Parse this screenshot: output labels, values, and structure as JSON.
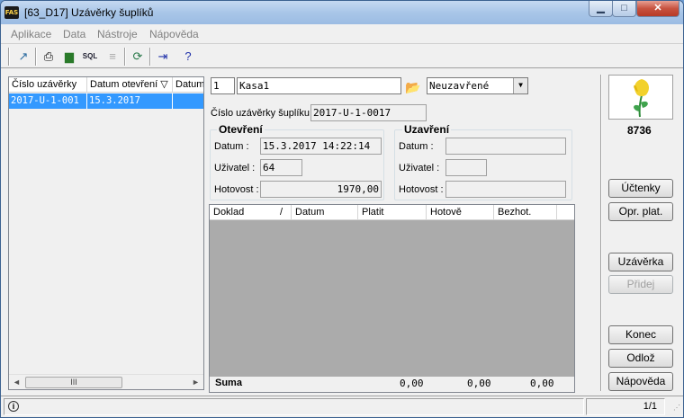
{
  "window": {
    "title": "[63_D17] Uzávěrky šuplíků",
    "app_icon": "FAS"
  },
  "menu": [
    "Aplikace",
    "Data",
    "Nástroje",
    "Nápověda"
  ],
  "toolbar": {
    "sql_label": "SQL"
  },
  "list": {
    "columns": [
      "Číslo uzávěrky",
      "Datum otevření",
      "Datum"
    ],
    "sort_indicator": "▽",
    "rows": [
      {
        "cislo": "2017-U-1-001",
        "datum_otevreni": "15.3.2017"
      }
    ],
    "scroll_thumb": "III"
  },
  "form": {
    "kasa_num": "1",
    "kasa_name": "Kasa1",
    "state": "Neuzavřené",
    "cislo_label": "Číslo uzávěrky šuplíku",
    "cislo_value": "2017-U-1-0017",
    "opening": {
      "title": "Otevření",
      "datum_label": "Datum :",
      "datum_value": "15.3.2017 14:22:14",
      "uzivatel_label": "Uživatel :",
      "uzivatel_value": "64",
      "hotovost_label": "Hotovost :",
      "hotovost_value": "1970,00"
    },
    "closing": {
      "title": "Uzavření",
      "datum_label": "Datum :",
      "datum_value": "",
      "uzivatel_label": "Uživatel :",
      "uzivatel_value": "",
      "hotovost_label": "Hotovost :",
      "hotovost_value": ""
    }
  },
  "grid": {
    "columns": [
      "Doklad",
      "Datum",
      "Platit",
      "Hotově",
      "Bezhot."
    ],
    "sort_indicator": "/",
    "footer": {
      "label": "Suma",
      "platit": "0,00",
      "hotove": "0,00",
      "bezhot": "0,00"
    }
  },
  "side": {
    "number": "8736",
    "buttons": {
      "uctenky": "Účtenky",
      "opr_plat": "Opr. plat.",
      "uzaverka": "Uzávěrka",
      "pridej": "Přidej",
      "konec": "Konec",
      "odloz": "Odlož",
      "napoveda": "Nápověda"
    }
  },
  "status": {
    "page": "1/1"
  },
  "colors": {
    "selection": "#3399ff",
    "grid_bg": "#ababab"
  }
}
